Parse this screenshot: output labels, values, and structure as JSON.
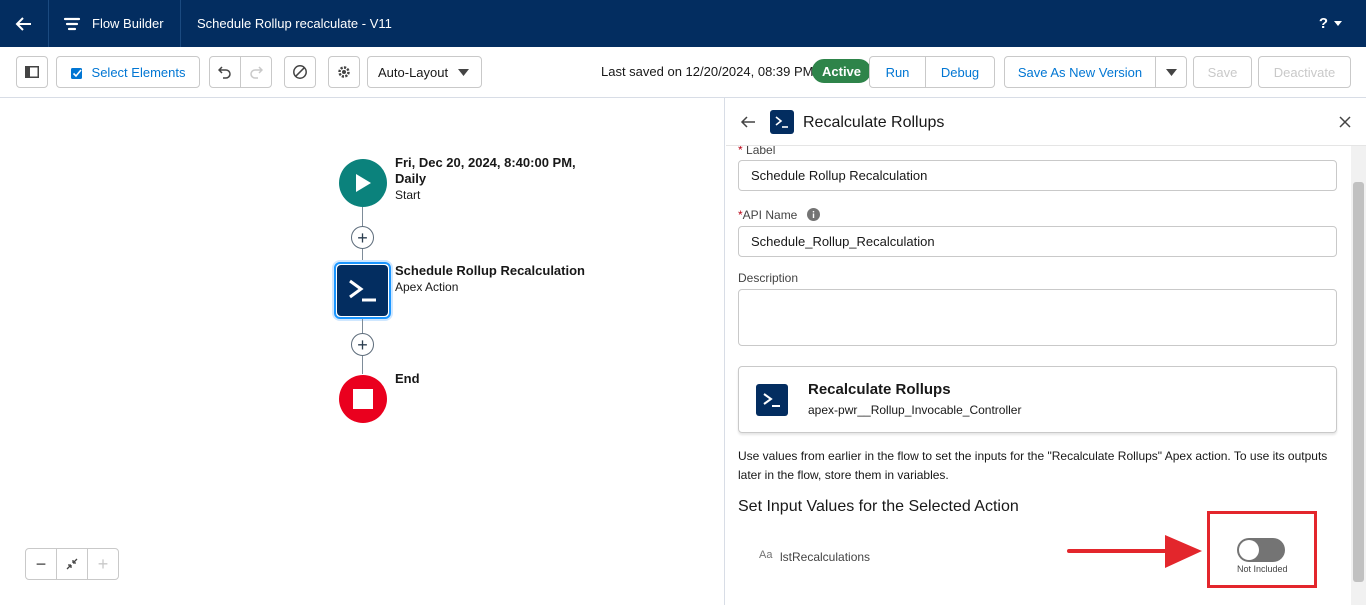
{
  "topbar": {
    "app_name": "Flow Builder",
    "flow_title": "Schedule Rollup recalculate - V11",
    "help_label": "?"
  },
  "toolbar": {
    "select_elements": "Select Elements",
    "layout_mode": "Auto-Layout",
    "last_saved": "Last saved on 12/20/2024, 08:39 PM",
    "status_badge": "Active",
    "run": "Run",
    "debug": "Debug",
    "save_as_new_version": "Save As New Version",
    "save": "Save",
    "deactivate": "Deactivate"
  },
  "canvas": {
    "start_node": {
      "title": "Fri, Dec 20, 2024, 8:40:00 PM,",
      "title2": "Daily",
      "subtitle": "Start"
    },
    "action_node": {
      "title": "Schedule Rollup Recalculation",
      "subtitle": "Apex Action"
    },
    "end_node": {
      "title": "End"
    }
  },
  "panel": {
    "header_title": "Recalculate Rollups",
    "label_field_label": "Label",
    "label_value": "Schedule Rollup Recalculation",
    "api_name_label": "API Name",
    "api_name_value": "Schedule_Rollup_Recalculation",
    "description_label": "Description",
    "description_value": "",
    "action_card": {
      "title": "Recalculate Rollups",
      "subtitle": "apex-pwr__Rollup_Invocable_Controller"
    },
    "help_text": "Use values from earlier in the flow to set the inputs for the \"Recalculate Rollups\" Apex action. To use its outputs later in the flow, store them in variables.",
    "section_title": "Set Input Values for the Selected Action",
    "input_param": {
      "type_icon": "Aa",
      "name": "lstRecalculations",
      "toggle_label": "Not Included",
      "included": false
    }
  },
  "colors": {
    "header_bg": "#032d60",
    "brand": "#0176d3",
    "start": "#0b827c",
    "action": "#032d60",
    "end": "#ea001e",
    "active": "#2e844a",
    "annotation": "#e3262c"
  }
}
